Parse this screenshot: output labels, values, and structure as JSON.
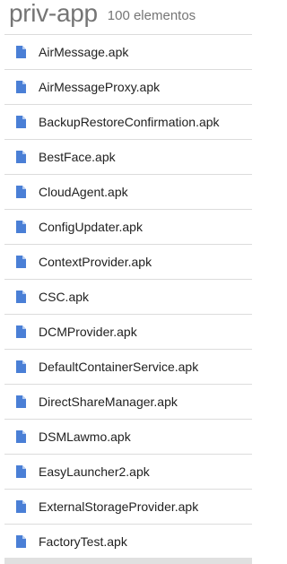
{
  "header": {
    "title": "priv-app",
    "count": "100 elementos"
  },
  "icon": "file-icon",
  "colors": {
    "icon": "#4a7fd6",
    "divider": "#dcdcdc",
    "title": "#757575"
  },
  "files": [
    {
      "name": "AirMessage.apk"
    },
    {
      "name": "AirMessageProxy.apk"
    },
    {
      "name": "BackupRestoreConfirmation.apk"
    },
    {
      "name": "BestFace.apk"
    },
    {
      "name": "CloudAgent.apk"
    },
    {
      "name": "ConfigUpdater.apk"
    },
    {
      "name": "ContextProvider.apk"
    },
    {
      "name": "CSC.apk"
    },
    {
      "name": "DCMProvider.apk"
    },
    {
      "name": "DefaultContainerService.apk"
    },
    {
      "name": "DirectShareManager.apk"
    },
    {
      "name": "DSMLawmo.apk"
    },
    {
      "name": "EasyLauncher2.apk"
    },
    {
      "name": "ExternalStorageProvider.apk"
    },
    {
      "name": "FactoryTest.apk"
    }
  ]
}
